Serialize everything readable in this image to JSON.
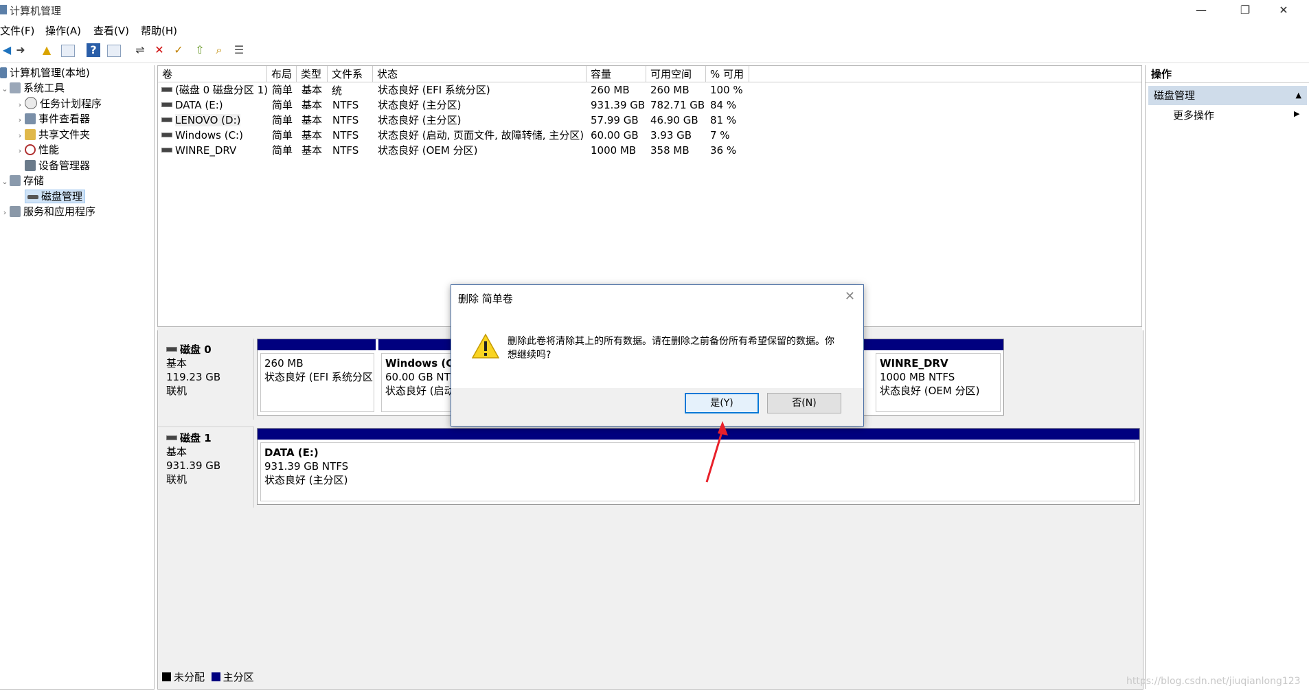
{
  "window": {
    "title": "计算机管理",
    "controls": {
      "minimize": "—",
      "restore": "❐",
      "close": "✕"
    }
  },
  "menu": [
    "文件(F)",
    "操作(A)",
    "查看(V)",
    "帮助(H)"
  ],
  "tree": {
    "root": "计算机管理(本地)",
    "system_tools": "系统工具",
    "task_scheduler": "任务计划程序",
    "event_viewer": "事件查看器",
    "shared_folders": "共享文件夹",
    "performance": "性能",
    "device_manager": "设备管理器",
    "storage": "存储",
    "disk_management": "磁盘管理",
    "services_apps": "服务和应用程序"
  },
  "volume_table": {
    "headers": [
      "卷",
      "布局",
      "类型",
      "文件系统",
      "状态",
      "容量",
      "可用空间",
      "% 可用"
    ],
    "rows": [
      [
        "(磁盘 0 磁盘分区 1)",
        "简单",
        "基本",
        "",
        "状态良好 (EFI 系统分区)",
        "260 MB",
        "260 MB",
        "100 %"
      ],
      [
        "DATA (E:)",
        "简单",
        "基本",
        "NTFS",
        "状态良好 (主分区)",
        "931.39 GB",
        "782.71 GB",
        "84 %"
      ],
      [
        "LENOVO (D:)",
        "简单",
        "基本",
        "NTFS",
        "状态良好 (主分区)",
        "57.99 GB",
        "46.90 GB",
        "81 %"
      ],
      [
        "Windows (C:)",
        "简单",
        "基本",
        "NTFS",
        "状态良好 (启动, 页面文件, 故障转储, 主分区)",
        "60.00 GB",
        "3.93 GB",
        "7 %"
      ],
      [
        "WINRE_DRV",
        "简单",
        "基本",
        "NTFS",
        "状态良好 (OEM 分区)",
        "1000 MB",
        "358 MB",
        "36 %"
      ]
    ]
  },
  "disks": [
    {
      "name": "磁盘 0",
      "kind": "基本",
      "size": "119.23 GB",
      "status": "联机",
      "partitions": [
        {
          "line1": "",
          "line2": "260 MB",
          "line3": "状态良好 (EFI 系统分区)"
        },
        {
          "line1": "Windows  (C",
          "line2": "60.00 GB NTF",
          "line3": "状态良好 (启动"
        },
        {
          "line1": "WINRE_DRV",
          "line2": "1000 MB NTFS",
          "line3": "状态良好 (OEM 分区)"
        }
      ]
    },
    {
      "name": "磁盘 1",
      "kind": "基本",
      "size": "931.39 GB",
      "status": "联机",
      "partitions": [
        {
          "line1": "DATA  (E:)",
          "line2": "931.39 GB NTFS",
          "line3": "状态良好 (主分区)"
        }
      ]
    }
  ],
  "legend": {
    "unallocated": "未分配",
    "primary": "主分区"
  },
  "actions": {
    "header": "操作",
    "section": "磁盘管理",
    "more": "更多操作"
  },
  "dialog": {
    "title": "删除 简单卷",
    "message": "删除此卷将清除其上的所有数据。请在删除之前备份所有希望保留的数据。你想继续吗?",
    "yes": "是(Y)",
    "no": "否(N)"
  },
  "watermark": "https://blog.csdn.net/jiuqianlong123",
  "colors": {
    "partition_bar": "#00007f",
    "accent": "#0078d7",
    "annotation_arrow": "#e8202a"
  }
}
